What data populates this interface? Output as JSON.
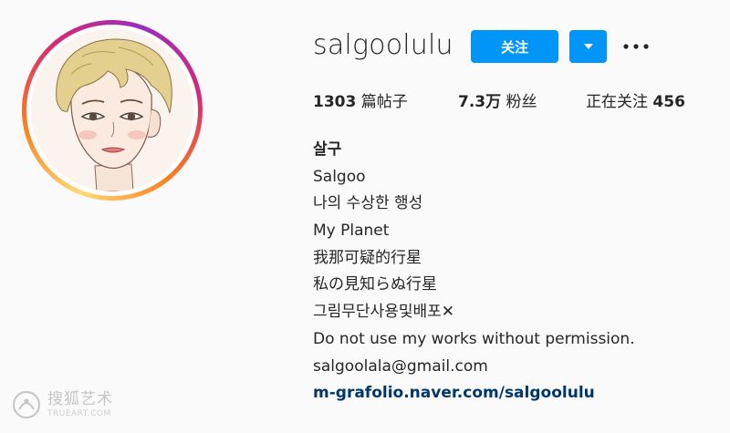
{
  "profile": {
    "username": "salgoolulu",
    "follow_label": "关注",
    "dropdown_icon": "caret-down-icon",
    "more_icon": "more-options-icon"
  },
  "stats": {
    "posts_count": "1303",
    "posts_label": "篇帖子",
    "followers_count": "7.3万",
    "followers_label": "粉丝",
    "following_label": "正在关注",
    "following_count": "456"
  },
  "bio": {
    "name": "살구",
    "lines": [
      "Salgoo",
      "나의 수상한 행성",
      "My Planet",
      "我那可疑的行星",
      "私の見知らぬ行星",
      "그림무단사용및배포",
      "Do not use my works without permission.",
      "salgoolala@gmail.com"
    ],
    "cross_mark": "✕",
    "link": "m-grafolio.naver.com/salgoolulu"
  },
  "watermark": {
    "main": "搜狐艺术",
    "sub": "TRUEART.COM"
  },
  "colors": {
    "accent": "#0095f6",
    "link": "#00376b",
    "text": "#262626",
    "background": "#fafafa"
  }
}
